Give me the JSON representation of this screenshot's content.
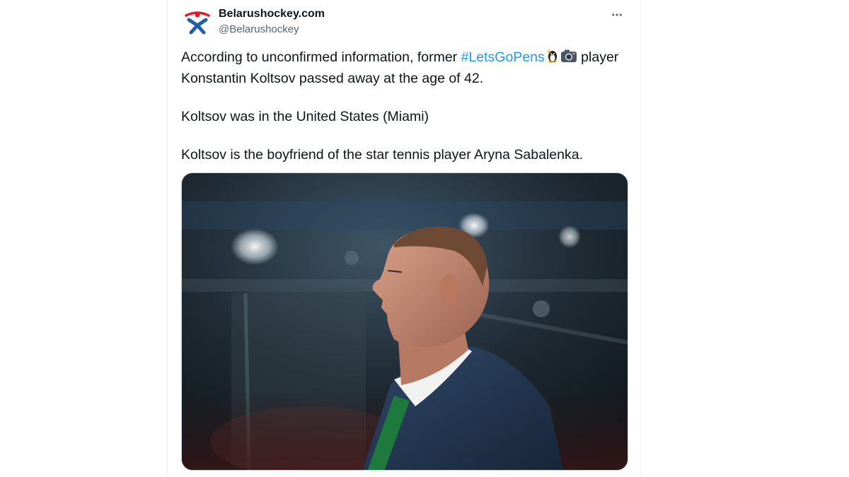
{
  "tweet": {
    "author": {
      "display_name": "Belarushockey.com",
      "handle": "@Belarushockey",
      "avatar_icon": "belarushockey-logo-icon"
    },
    "more_icon": "more-horizontal-icon",
    "paragraph1_before": "According to unconfirmed information, former ",
    "hashtag": "#LetsGoPens",
    "emojis": [
      "penguin-emoji",
      "camera-emoji"
    ],
    "paragraph1_after": " player Konstantin Koltsov passed away at the age of 42.",
    "paragraph2": "Koltsov was in the United States (Miami)",
    "paragraph3": "Koltsov is the boyfriend of the star tennis player Aryna Sabalenka.",
    "media": {
      "description_icon": "photo-koltsov-profile"
    }
  },
  "colors": {
    "text": "#0f1419",
    "secondary": "#536471",
    "link": "#1d9bf0",
    "border": "#cfd9de",
    "logo_red": "#e11d2a",
    "logo_blue": "#1f5fa8"
  }
}
